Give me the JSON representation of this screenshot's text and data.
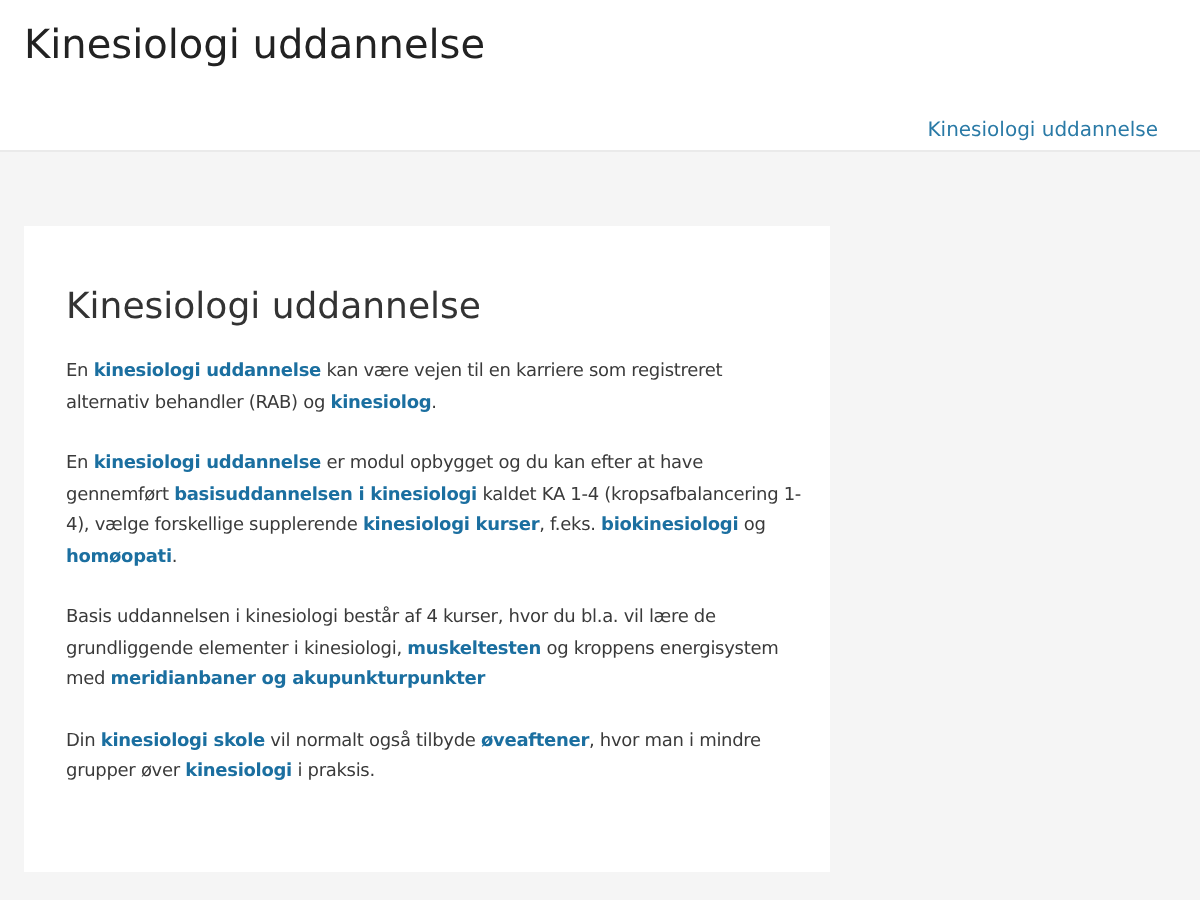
{
  "header": {
    "site_title": "Kinesiologi uddannelse",
    "nav_items": [
      {
        "label": "Kinesiologi uddannelse"
      }
    ]
  },
  "article": {
    "title": "Kinesiologi uddannelse",
    "paragraphs": [
      [
        {
          "kind": "text",
          "text": "En "
        },
        {
          "kind": "link",
          "text": "kinesiologi uddannelse"
        },
        {
          "kind": "text",
          "text": " kan være vejen til en karriere som registreret alternativ behandler (RAB) og "
        },
        {
          "kind": "link",
          "text": "kinesiolog"
        },
        {
          "kind": "text",
          "text": "."
        }
      ],
      [
        {
          "kind": "text",
          "text": "En "
        },
        {
          "kind": "link",
          "text": "kinesiologi uddannelse"
        },
        {
          "kind": "text",
          "text": " er modul opbygget og du kan efter at have gennemført "
        },
        {
          "kind": "link",
          "text": "basisuddannelsen i kinesiologi"
        },
        {
          "kind": "text",
          "text": " kaldet KA 1-4 (kropsafbalancering 1-4), vælge forskellige supplerende "
        },
        {
          "kind": "link",
          "text": "kinesiologi kurser"
        },
        {
          "kind": "text",
          "text": ", f.eks. "
        },
        {
          "kind": "link",
          "text": "biokinesiologi"
        },
        {
          "kind": "text",
          "text": " og "
        },
        {
          "kind": "link",
          "text": "homøopati"
        },
        {
          "kind": "text",
          "text": "."
        }
      ],
      [
        {
          "kind": "text",
          "text": "Basis uddannelsen i kinesiologi består af 4 kurser, hvor du bl.a. vil lære de grundliggende elementer i kinesiologi, "
        },
        {
          "kind": "link",
          "text": "muskeltesten"
        },
        {
          "kind": "text",
          "text": " og kroppens energisystem med "
        },
        {
          "kind": "link",
          "text": "meridianbaner og akupunkturpunkter"
        }
      ],
      [
        {
          "kind": "text",
          "text": "Din "
        },
        {
          "kind": "link",
          "text": "kinesiologi skole"
        },
        {
          "kind": "text",
          "text": " vil normalt også tilbyde "
        },
        {
          "kind": "link",
          "text": "øveaftener"
        },
        {
          "kind": "text",
          "text": ", hvor man i mindre grupper øver "
        },
        {
          "kind": "link",
          "text": "kinesiologi"
        },
        {
          "kind": "text",
          "text": " i praksis."
        }
      ]
    ]
  }
}
